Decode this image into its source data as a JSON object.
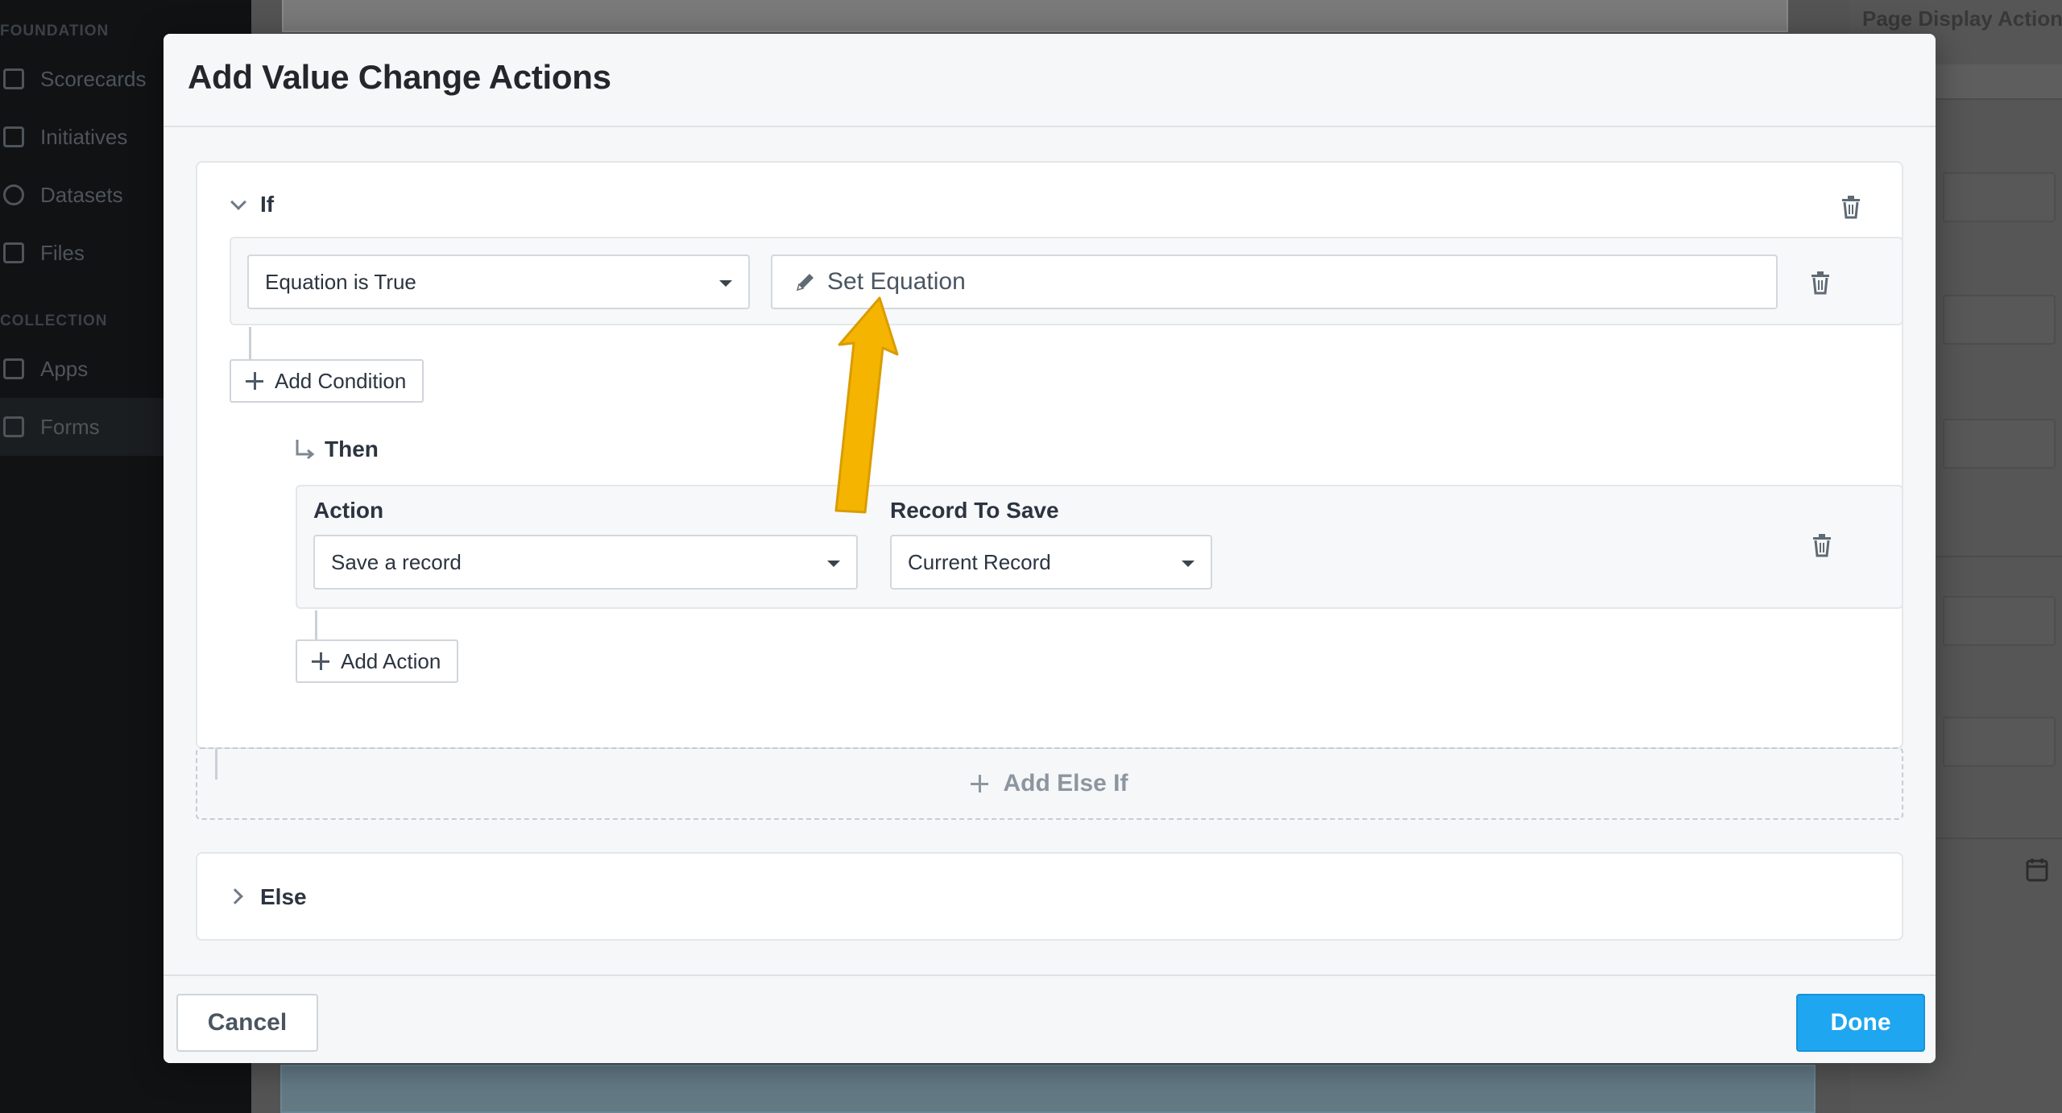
{
  "background": {
    "sidebar": {
      "section_foundation": "FOUNDATION",
      "section_collection": "COLLECTION",
      "items": [
        {
          "label": "Scorecards",
          "icon": "grid-icon"
        },
        {
          "label": "Initiatives",
          "icon": "checkbox-icon"
        },
        {
          "label": "Datasets",
          "icon": "cube-icon"
        },
        {
          "label": "Files",
          "icon": "file-icon"
        },
        {
          "label": "Apps",
          "icon": "app-icon"
        },
        {
          "label": "Forms",
          "icon": "form-icon"
        }
      ]
    },
    "right_panel": {
      "title": "Page Display Actions"
    }
  },
  "modal": {
    "title": "Add Value Change Actions",
    "if_block": {
      "label": "If",
      "condition": {
        "type_value": "Equation is True",
        "equation_label": "Set Equation"
      },
      "add_condition_label": "Add Condition",
      "then_label": "Then",
      "action": {
        "action_label": "Action",
        "action_value": "Save a record",
        "record_label": "Record To Save",
        "record_value": "Current Record"
      },
      "add_action_label": "Add Action"
    },
    "add_else_if_label": "Add Else If",
    "else_label": "Else",
    "footer": {
      "cancel_label": "Cancel",
      "done_label": "Done"
    }
  },
  "colors": {
    "accent": "#1ea7f0",
    "annotation_arrow": "#f5b400"
  }
}
